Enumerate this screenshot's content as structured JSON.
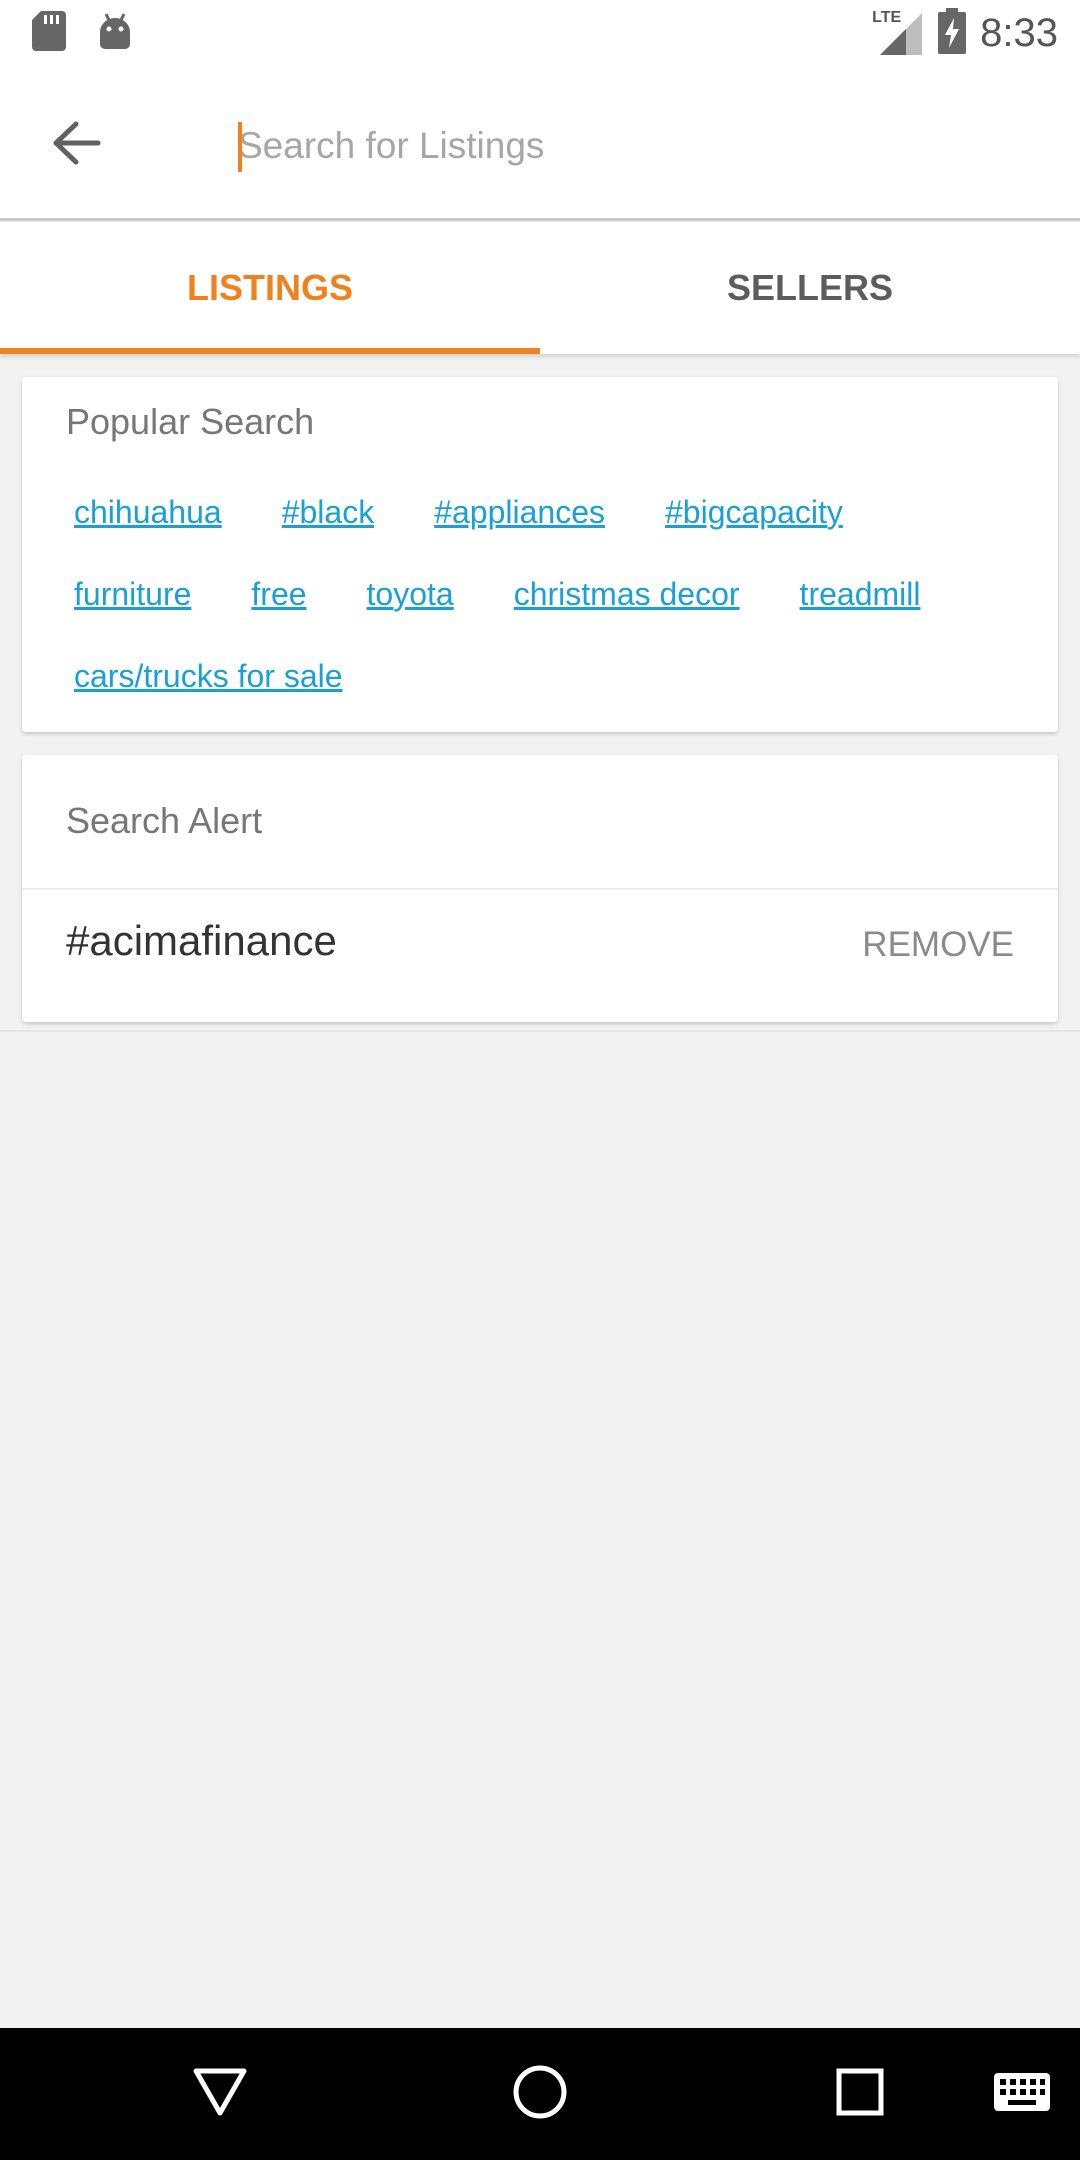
{
  "status_bar": {
    "time": "8:33",
    "network_label": "LTE",
    "icons": [
      "sd-card-icon",
      "android-icon",
      "signal-icon",
      "battery-charging-icon"
    ]
  },
  "toolbar": {
    "back_icon": "arrow-left-icon",
    "search_placeholder": "Search for Listings",
    "search_value": ""
  },
  "tabs": [
    {
      "label": "LISTINGS",
      "active": true
    },
    {
      "label": "SELLERS",
      "active": false
    }
  ],
  "popular_search": {
    "title": "Popular Search",
    "rows": [
      [
        "chihuahua",
        "#black",
        "#appliances",
        "#bigcapacity"
      ],
      [
        "furniture",
        "free",
        "toyota",
        "christmas decor",
        "treadmill"
      ],
      [
        "cars/trucks for sale"
      ]
    ]
  },
  "search_alert": {
    "title": "Search Alert",
    "items": [
      {
        "term": "#acimafinance",
        "action_label": "REMOVE"
      }
    ]
  },
  "nav_bar": {
    "icons": [
      "back-triangle-icon",
      "home-circle-icon",
      "recents-square-icon",
      "keyboard-icon"
    ]
  },
  "colors": {
    "accent": "#f0821e",
    "link": "#1a9fd6",
    "background": "#f2f2f2"
  }
}
